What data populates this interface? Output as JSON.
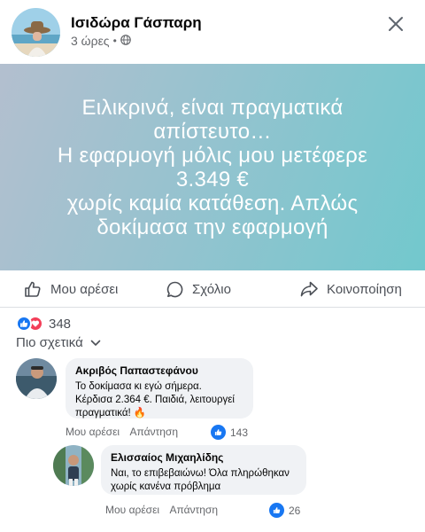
{
  "post": {
    "author": "Ισιδώρα Γάσπαρη",
    "time": "3 ώρες",
    "separator": "•",
    "banner_lines": [
      "Ειλικρινά, είναι πραγματικά",
      "απίστευτο…",
      "Η εφαρμογή μόλις μου μετέφερε",
      "3.349 €",
      "χωρίς καμία κατάθεση. Απλώς",
      "δοκίμασα την εφαρμογή"
    ],
    "banner_colors": {
      "start": "#b3bfcf",
      "mid": "#93c3cf",
      "end": "#72c8cd"
    }
  },
  "actions": {
    "like": "Μου αρέσει",
    "comment": "Σχόλιο",
    "share": "Κοινοποίηση"
  },
  "reactions": {
    "count": "348",
    "icons": [
      "like-icon",
      "love-icon"
    ]
  },
  "sort": {
    "label": "Πιο σχετικά"
  },
  "comments": [
    {
      "name": "Ακριβός Παπαστεφάνου",
      "text_lines": [
        "Το δοκίμασα κι εγώ σήμερα.",
        "Κέρδισα 2.364 €. Παιδιά, λειτουργεί",
        "πραγματικά! 🔥"
      ],
      "like_label": "Μου αρέσει",
      "reply_label": "Απάντηση",
      "likes": "143"
    },
    {
      "name": "Ελισσαίος Μιχαηλίδης",
      "text_lines": [
        "Ναι, το επιβεβαιώνω! Όλα πληρώθηκαν",
        "χωρίς κανένα πρόβλημα"
      ],
      "like_label": "Μου αρέσει",
      "reply_label": "Απάντηση",
      "likes": "26"
    }
  ],
  "colors": {
    "accent": "#1877f2",
    "love": "#f33e58",
    "muted": "#65676b",
    "bubble": "#f0f2f5"
  }
}
